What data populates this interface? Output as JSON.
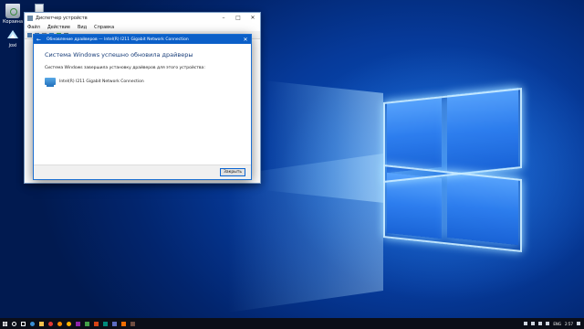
{
  "desktop": {
    "icons": [
      {
        "label": "Корзина"
      },
      {
        "label": "joxi"
      }
    ]
  },
  "device_manager": {
    "title": "Диспетчер устройств",
    "menu": [
      "Файл",
      "Действие",
      "Вид",
      "Справка"
    ]
  },
  "dialog": {
    "title": "Обновление драйверов — Intel(R) I211 Gigabit Network Connection",
    "heading": "Система Windows успешно обновила драйверы",
    "message": "Система Windows завершила установку драйверов для этого устройства:",
    "device_name": "Intel(R) I211 Gigabit Network Connection",
    "close_button": "Закрыть"
  },
  "taskbar": {
    "language": "ENG",
    "time": "2:57"
  },
  "colors": {
    "accent": "#0b5fc8",
    "taskbar": "#0b0e18",
    "wallpaper": "#063a9a"
  }
}
